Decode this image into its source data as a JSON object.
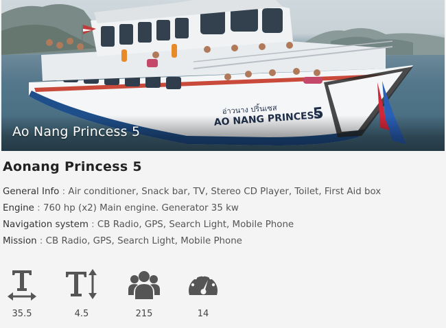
{
  "photo": {
    "caption": "Ao Nang Princess 5",
    "hull_name": "AO NANG PRINCESS",
    "hull_number": "5",
    "hull_thai": "อ่าวนาง ปริ้นเซส"
  },
  "boat": {
    "title": "Aonang Princess 5",
    "specs": [
      {
        "label": "General Info",
        "value": "Air conditioner, Snack bar, TV, Stereo CD Player, Toilet, First Aid box"
      },
      {
        "label": "Engine",
        "value": "760 hp (x2) Main engine. Generator 35 kw"
      },
      {
        "label": "Navigation system",
        "value": "CB Radio, GPS, Search Light, Mobile Phone"
      },
      {
        "label": "Mission",
        "value": "CB Radio, GPS, Search Light, Mobile Phone"
      }
    ]
  },
  "stats": [
    {
      "icon": "length-icon",
      "value": "35.5"
    },
    {
      "icon": "height-icon",
      "value": "4.5"
    },
    {
      "icon": "passengers-icon",
      "value": "215"
    },
    {
      "icon": "speed-icon",
      "value": "14"
    }
  ],
  "colors": {
    "icon": "#555555",
    "title": "#222222",
    "text": "#555555"
  }
}
